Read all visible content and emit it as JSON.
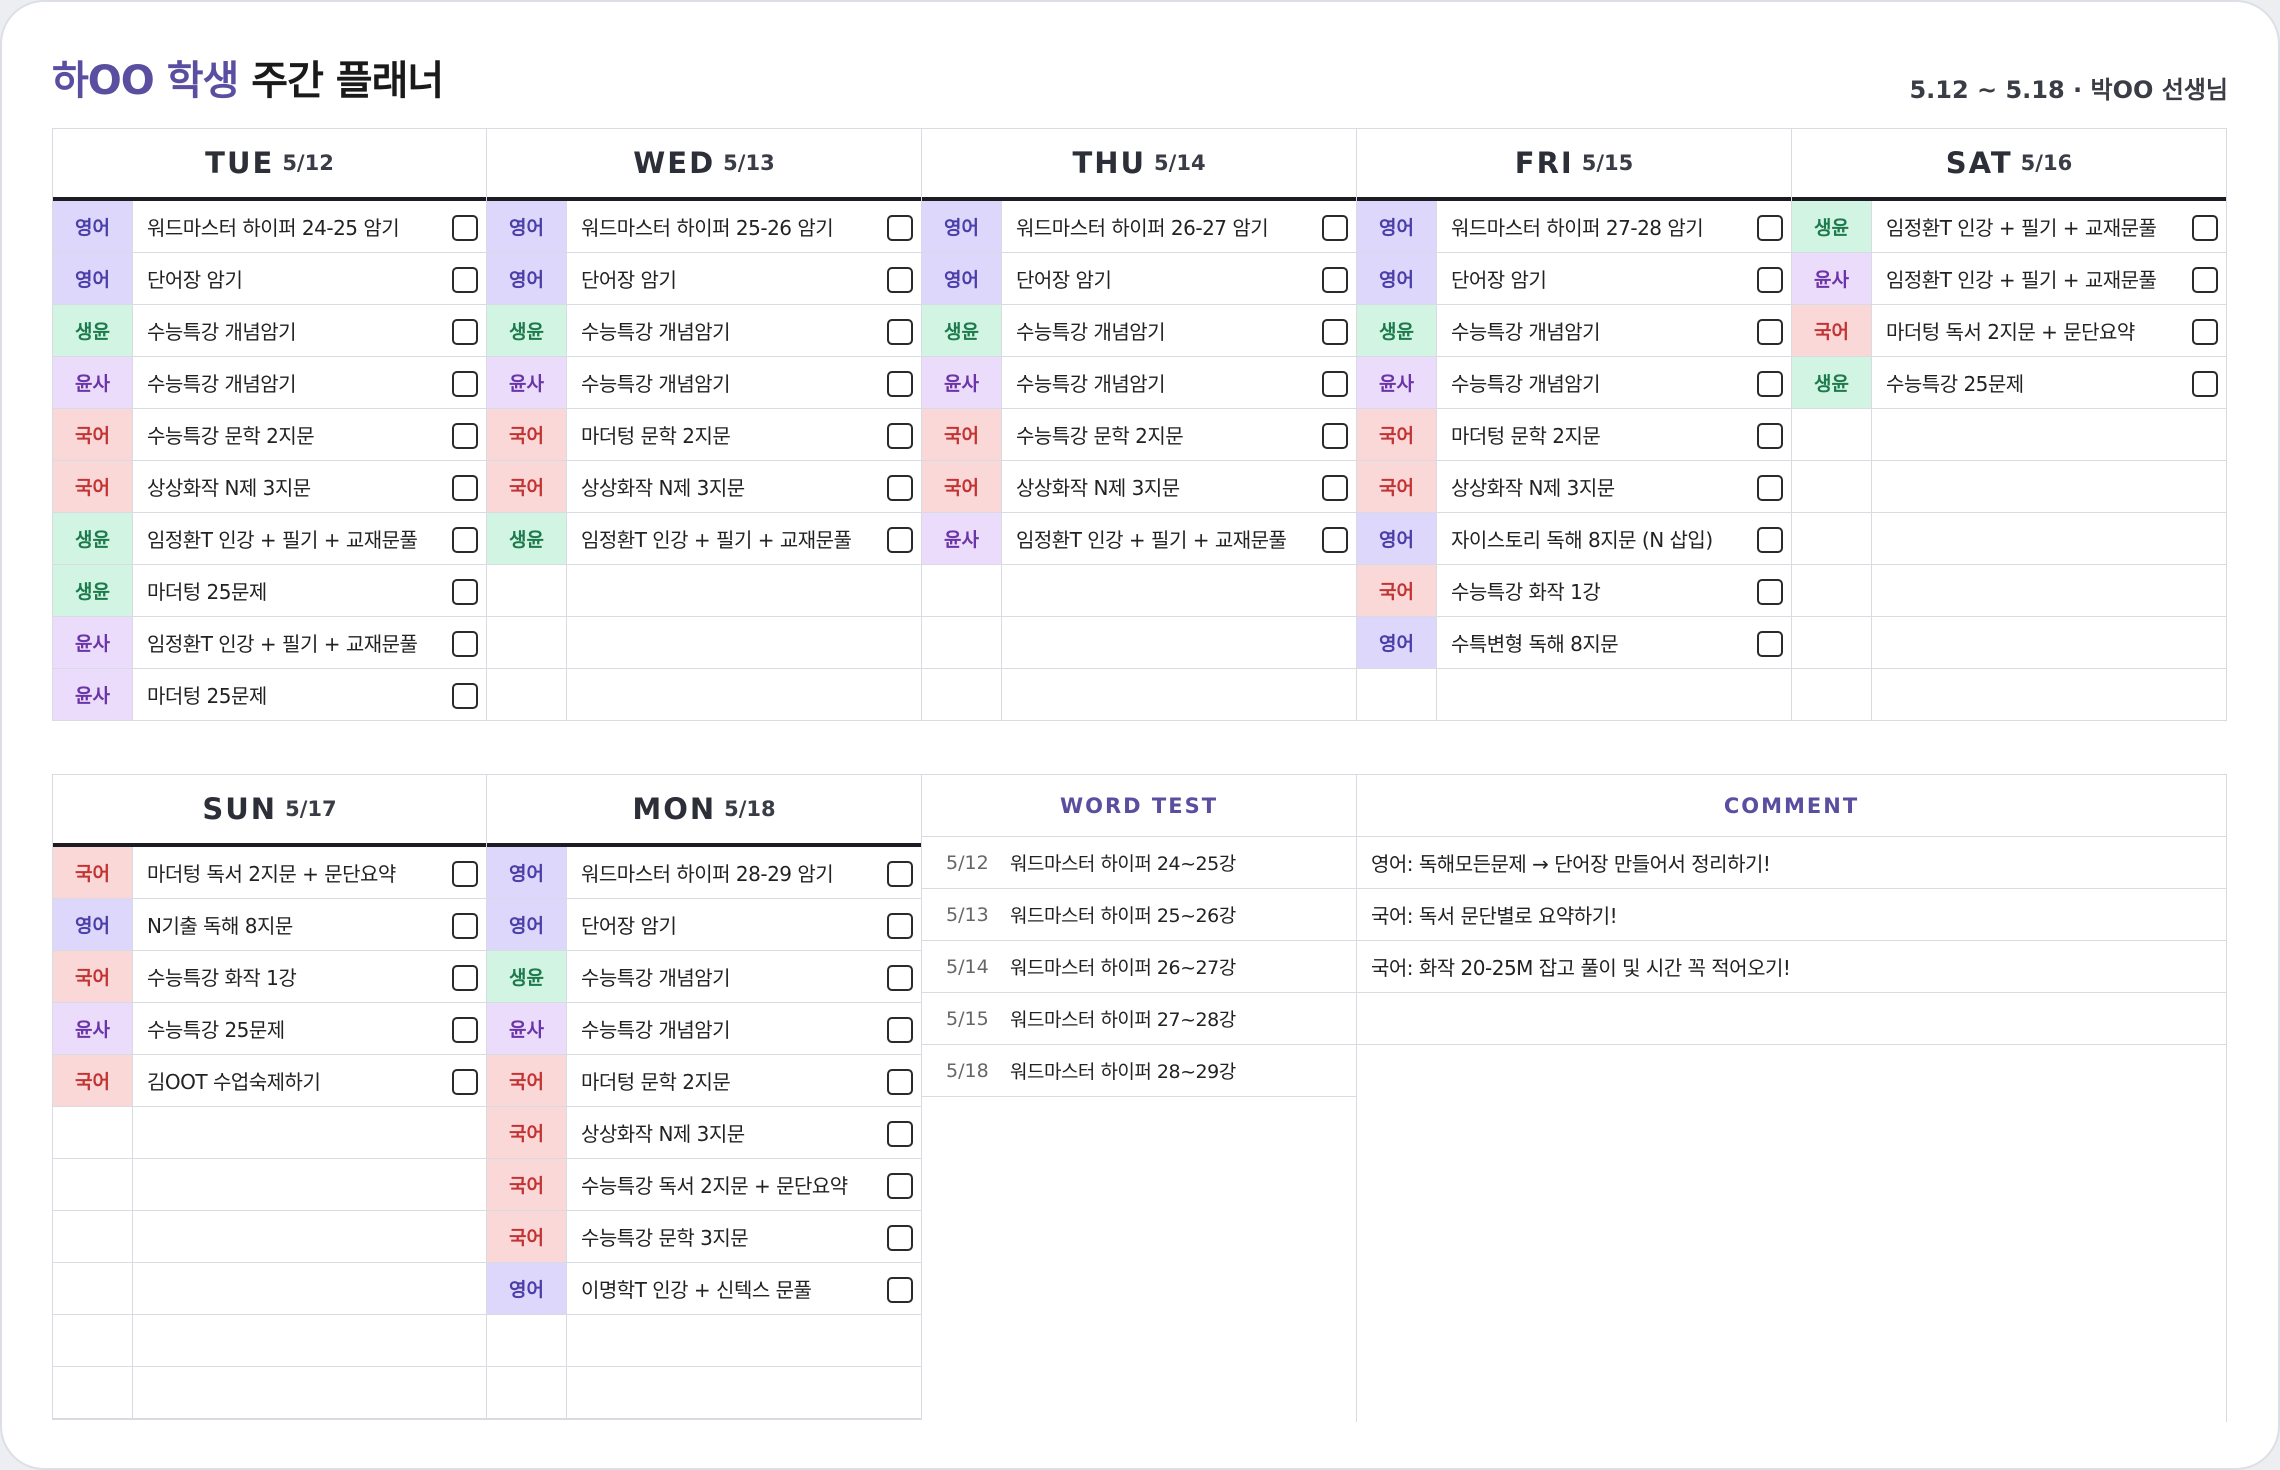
{
  "header": {
    "title_accent": "하OO 학생",
    "title_rest": "주간 플래너",
    "subtitle": "5.12 ~ 5.18 · 박OO 선생님"
  },
  "subject_colors": {
    "영어": {
      "bg": "#ddd8fb",
      "fg": "#4a3ea8"
    },
    "생윤": {
      "bg": "#d2f5e3",
      "fg": "#1d7a4c"
    },
    "윤사": {
      "bg": "#ecdcfb",
      "fg": "#6a35a8"
    },
    "국어": {
      "bg": "#fbd8d8",
      "fg": "#c23434"
    }
  },
  "days": [
    {
      "name": "TUE",
      "date": "5/12",
      "tasks": [
        {
          "subject": "영어",
          "text": "워드마스터 하이퍼 24-25 암기"
        },
        {
          "subject": "영어",
          "text": "단어장 암기"
        },
        {
          "subject": "생윤",
          "text": "수능특강 개념암기"
        },
        {
          "subject": "윤사",
          "text": "수능특강 개념암기"
        },
        {
          "subject": "국어",
          "text": "수능특강 문학 2지문"
        },
        {
          "subject": "국어",
          "text": "상상화작 N제 3지문"
        },
        {
          "subject": "생윤",
          "text": "임정환T 인강 + 필기 + 교재문풀"
        },
        {
          "subject": "생윤",
          "text": "마더텅 25문제"
        },
        {
          "subject": "윤사",
          "text": "임정환T 인강 + 필기 + 교재문풀"
        },
        {
          "subject": "윤사",
          "text": "마더텅 25문제"
        }
      ]
    },
    {
      "name": "WED",
      "date": "5/13",
      "tasks": [
        {
          "subject": "영어",
          "text": "워드마스터 하이퍼 25-26 암기"
        },
        {
          "subject": "영어",
          "text": "단어장 암기"
        },
        {
          "subject": "생윤",
          "text": "수능특강 개념암기"
        },
        {
          "subject": "윤사",
          "text": "수능특강 개념암기"
        },
        {
          "subject": "국어",
          "text": "마더텅 문학 2지문"
        },
        {
          "subject": "국어",
          "text": "상상화작 N제 3지문"
        },
        {
          "subject": "생윤",
          "text": "임정환T 인강 + 필기 + 교재문풀"
        }
      ]
    },
    {
      "name": "THU",
      "date": "5/14",
      "tasks": [
        {
          "subject": "영어",
          "text": "워드마스터 하이퍼 26-27 암기"
        },
        {
          "subject": "영어",
          "text": "단어장 암기"
        },
        {
          "subject": "생윤",
          "text": "수능특강 개념암기"
        },
        {
          "subject": "윤사",
          "text": "수능특강 개념암기"
        },
        {
          "subject": "국어",
          "text": "수능특강 문학 2지문"
        },
        {
          "subject": "국어",
          "text": "상상화작 N제 3지문"
        },
        {
          "subject": "윤사",
          "text": "임정환T 인강 + 필기 + 교재문풀"
        }
      ]
    },
    {
      "name": "FRI",
      "date": "5/15",
      "tasks": [
        {
          "subject": "영어",
          "text": "워드마스터 하이퍼 27-28 암기"
        },
        {
          "subject": "영어",
          "text": "단어장 암기"
        },
        {
          "subject": "생윤",
          "text": "수능특강 개념암기"
        },
        {
          "subject": "윤사",
          "text": "수능특강 개념암기"
        },
        {
          "subject": "국어",
          "text": "마더텅 문학 2지문"
        },
        {
          "subject": "국어",
          "text": "상상화작 N제 3지문"
        },
        {
          "subject": "영어",
          "text": "자이스토리 독해 8지문 (N 삽입)"
        },
        {
          "subject": "국어",
          "text": "수능특강 화작 1강"
        },
        {
          "subject": "영어",
          "text": "수특변형 독해 8지문"
        }
      ]
    },
    {
      "name": "SAT",
      "date": "5/16",
      "tasks": [
        {
          "subject": "생윤",
          "text": "임정환T 인강 + 필기 + 교재문풀"
        },
        {
          "subject": "윤사",
          "text": "임정환T 인강 + 필기 + 교재문풀"
        },
        {
          "subject": "국어",
          "text": "마더텅 독서 2지문 + 문단요약"
        },
        {
          "subject": "생윤",
          "text": "수능특강 25문제"
        }
      ]
    },
    {
      "name": "SUN",
      "date": "5/17",
      "tasks": [
        {
          "subject": "국어",
          "text": "마더텅 독서 2지문 + 문단요약"
        },
        {
          "subject": "영어",
          "text": "N기출 독해 8지문"
        },
        {
          "subject": "국어",
          "text": "수능특강 화작 1강"
        },
        {
          "subject": "윤사",
          "text": "수능특강 25문제"
        },
        {
          "subject": "국어",
          "text": "김OOT 수업숙제하기"
        }
      ]
    },
    {
      "name": "MON",
      "date": "5/18",
      "tasks": [
        {
          "subject": "영어",
          "text": "워드마스터 하이퍼 28-29 암기"
        },
        {
          "subject": "영어",
          "text": "단어장 암기"
        },
        {
          "subject": "생윤",
          "text": "수능특강 개념암기"
        },
        {
          "subject": "윤사",
          "text": "수능특강 개념암기"
        },
        {
          "subject": "국어",
          "text": "마더텅 문학 2지문"
        },
        {
          "subject": "국어",
          "text": "상상화작 N제 3지문"
        },
        {
          "subject": "국어",
          "text": "수능특강 독서 2지문 + 문단요약"
        },
        {
          "subject": "국어",
          "text": "수능특강 문학 3지문"
        },
        {
          "subject": "영어",
          "text": "이명학T 인강 + 신텍스 문풀"
        }
      ]
    }
  ],
  "word_test": {
    "title": "WORD TEST",
    "rows": [
      {
        "date": "5/12",
        "text": "워드마스터 하이퍼 24~25강"
      },
      {
        "date": "5/13",
        "text": "워드마스터 하이퍼 25~26강"
      },
      {
        "date": "5/14",
        "text": "워드마스터 하이퍼 26~27강"
      },
      {
        "date": "5/15",
        "text": "워드마스터 하이퍼 27~28강"
      },
      {
        "date": "5/18",
        "text": "워드마스터 하이퍼 28~29강"
      }
    ]
  },
  "comment": {
    "title": "COMMENT",
    "rows": [
      "영어: 독해모든문제 → 단어장 만들어서 정리하기!",
      "국어: 독서 문단별로 요약하기!",
      "국어: 화작 20-25M 잡고 풀이 및 시간 꼭 적어오기!",
      ""
    ]
  }
}
